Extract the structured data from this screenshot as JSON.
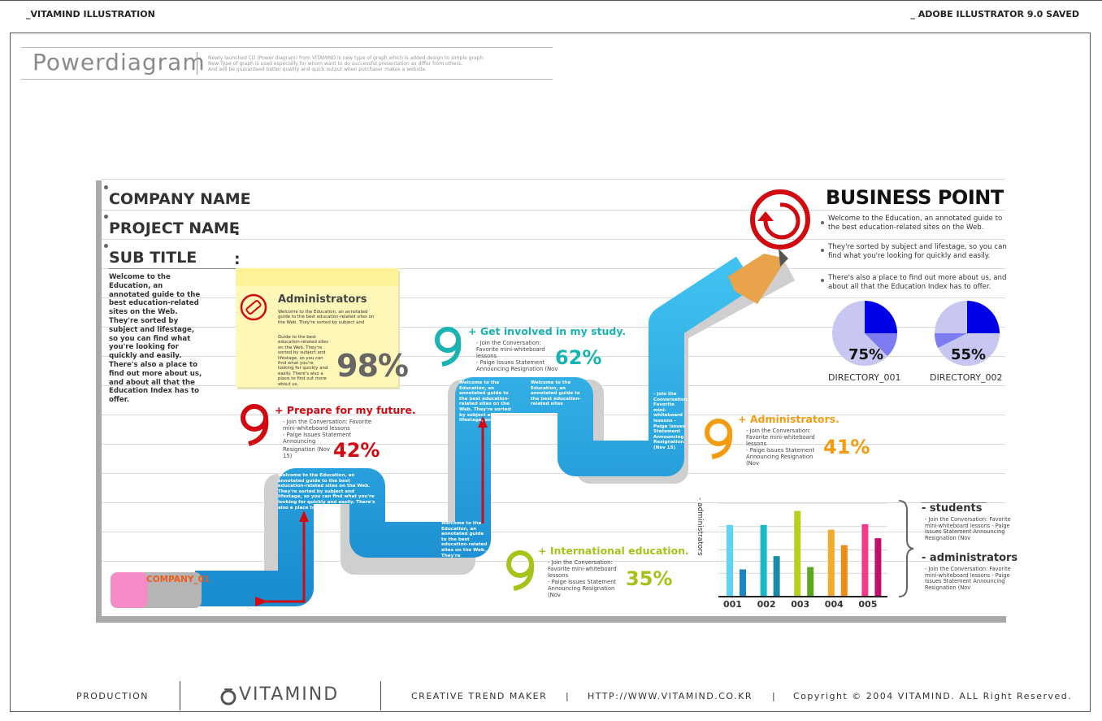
{
  "header": {
    "left": "_VITAMIND ILLUSTRATION",
    "right": "_ ADOBE ILLUSTRATOR 9.0 SAVED"
  },
  "page": {
    "title": "Powerdiagram",
    "description": [
      "Newly launched CD (Power diagram) from VITAMIND is new type of graph which is added design to simple graph.",
      "New Type of graph is used especially for whom want to do successful presentation as differ from others.",
      "And will be guaranteed better quality and quick output when purchaser makes a website."
    ]
  },
  "fields": {
    "company": "COMPANY  NAME",
    "project": "PROJECT NAME",
    "subtitle": "SUB TITLE",
    "colon": ":"
  },
  "intro": "Welcome to the Education, an annotated guide to the best education-related sites on the Web. They're sorted by subject and lifestage, so you can find what you're looking for quickly and easily. There's also a place to find out more about us, and about all that the Education Index has to offer.",
  "note": {
    "title": "Administrators",
    "text1": "Welcome to the Education, an annotated guide to the best education-related sites on the Web. They're sorted by subject and",
    "text2": "Guide to the best education-related sites on the Web. They're sorted by subject and lifestage, so you can find what you're looking for quickly and easily. There's also a place to find out more about us,",
    "pct": "98%"
  },
  "steps": {
    "s1": {
      "title": "+ Prepare for my future.",
      "sub1": "- Join the Conversation: Favorite mini-whiteboard lessons",
      "sub2": "- Paige Issues Statement Announcing",
      "sub3": "Resignation (Nov 15)",
      "pct": "42%"
    },
    "s2": {
      "title": "+ Get involved in my study.",
      "sub1": "- Join the Conversation: Favorite mini-whiteboard lessons",
      "sub2": "- Paige Issues Statement Announcing Resignation (Nov",
      "pct": "62%"
    },
    "s3": {
      "title": "+ International education.",
      "sub1": "- Join the Conversation: Favorite mini-whiteboard lessons",
      "sub2": "- Paige Issues Statement Announcing Resignation (Nov",
      "pct": "35%"
    },
    "s4": {
      "title": "+ Administrators.",
      "sub1": "- Join the Conversation: Favorite mini-whiteboard lessons",
      "sub2": "- Paige Issues Statement Announcing Resignation (Nov",
      "pct": "41%"
    }
  },
  "pencil_text": {
    "t1": "Welcome to the Education, an annotated guide to the best education-related sites on the Web. They're sorted by subject and lifestage, so you can find what you're looking for quickly and easily. There's also a place to find out",
    "t2": "Welcome to the Education, an annotated guide to the best education-related sites on the Web. They're",
    "t3": "Welcome to the Education, an annotated guide to the best education-related sites on the Web. They're sorted by subject and lifestage, so",
    "t4": "Welcome to the Education, an annotated guide to the best education-related sites",
    "t5": "- Join the Conversation: Favorite mini-whiteboard lessons - Paige Issues Statement Announcing Resignation (Nov 15)",
    "company": "COMPANY_01"
  },
  "business": {
    "title": "BUSINESS POINT",
    "items": [
      "Welcome to the Education, an annotated guide to the best education-related sites on the Web.",
      "They're sorted by subject and lifestage, so you can find what you're looking for quickly and easily.",
      "There's also a place to find out more about us, and about all that the Education Index has to offer."
    ]
  },
  "pies": [
    {
      "pct": "75%",
      "label": "DIRECTORY_001"
    },
    {
      "pct": "55%",
      "label": "DIRECTORY_002"
    }
  ],
  "colors": {
    "blue": "#29a8e0",
    "red": "#d10a11",
    "teal": "#19b3b1",
    "lime": "#a5c41a",
    "orange": "#f39c12",
    "pieLight": "#c7c7f2",
    "pieDark": "#0000e6"
  },
  "chart_data": {
    "type": "bar",
    "ylabel": "- administrators",
    "categories": [
      "001",
      "002",
      "003",
      "004",
      "005"
    ],
    "series": [
      {
        "values": [
          92,
          92,
          110,
          86,
          93
        ],
        "colors": [
          "#5fd3f3",
          "#19b8c2",
          "#b8cf1c",
          "#f2ac2a",
          "#ef3b8c"
        ]
      },
      {
        "values": [
          35,
          52,
          38,
          66,
          75
        ],
        "colors": [
          "#1c86c4",
          "#1a8aa6",
          "#5ea622",
          "#ee8a17",
          "#c20f6d"
        ]
      }
    ],
    "ylim": [
      0,
      120
    ],
    "grid": true
  },
  "legend": {
    "students": "- students",
    "students_sub": "- Join the Conversation: Favorite mini-whiteboard lessons - Paige Issues Statement Announcing Resignation (Nov",
    "admins": "- administrators",
    "admins_sub": "- Join the Conversation: Favorite mini-whiteboard lessons - Paige Issues Statement Announcing Resignation (Nov"
  },
  "footer": {
    "production": "PRODUCTION",
    "brand": "VITAMIND",
    "tagline": "CREATIVE TREND MAKER",
    "sep": "|",
    "url": "HTTP://WWW.VITAMIND.CO.KR",
    "copyright": "Copyright © 2004 VITAMIND. ALL Right Reserved."
  }
}
